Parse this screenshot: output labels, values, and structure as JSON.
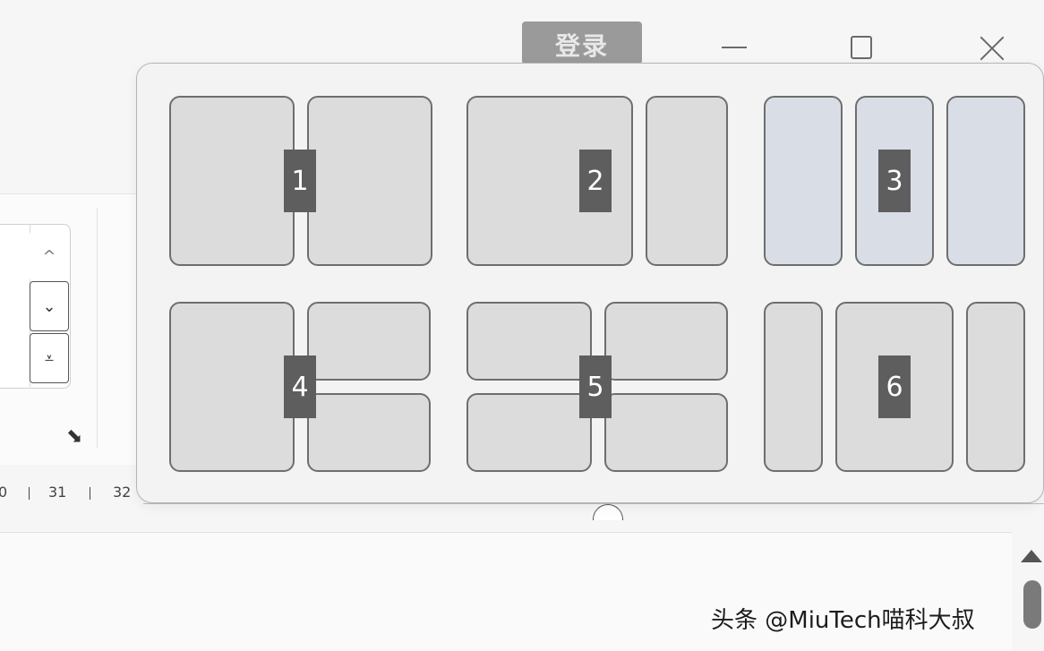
{
  "window": {
    "login_label": "登录",
    "minimize_icon": "minimize-icon",
    "maximize_icon": "maximize-icon",
    "close_icon": "close-icon"
  },
  "ribbon": {
    "spin_up_glyph": "^",
    "spin_down_glyph": "⌄",
    "spin_last_glyph": "⩡",
    "launcher_glyph": "⬊"
  },
  "ruler": {
    "labels": [
      "0",
      "31",
      "32"
    ]
  },
  "snap_layouts": {
    "layouts": [
      {
        "number": "1"
      },
      {
        "number": "2"
      },
      {
        "number": "3"
      },
      {
        "number": "4"
      },
      {
        "number": "5"
      },
      {
        "number": "6"
      }
    ]
  },
  "watermark": "头条 @MiuTech喵科大叔",
  "colors": {
    "zone_fill": "#dcdcdd",
    "zone_highlight": "#d9dee6",
    "number_badge": "#5e5e5e"
  }
}
